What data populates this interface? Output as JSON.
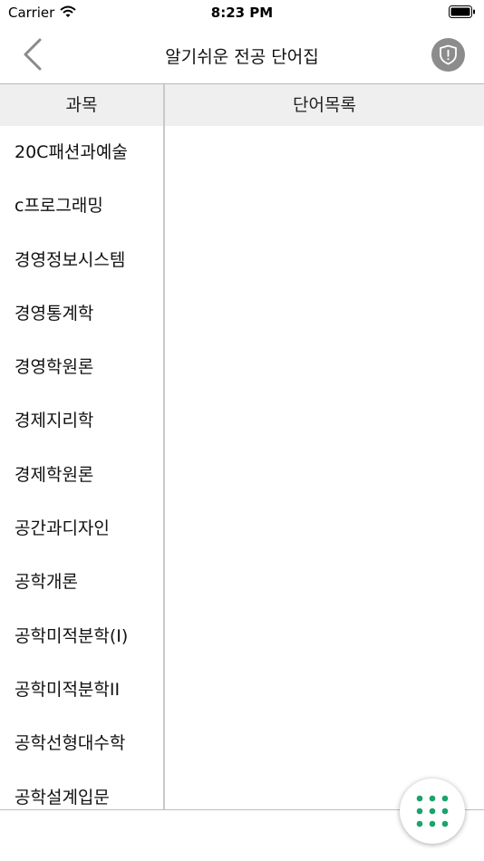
{
  "status_bar": {
    "carrier": "Carrier",
    "time": "8:23 PM"
  },
  "nav": {
    "title": "알기쉬운 전공 단어집",
    "back_icon": "chevron-left-icon",
    "report_icon": "shield-alert-icon"
  },
  "table": {
    "headers": {
      "subject": "과목",
      "words": "단어목록"
    },
    "subjects": [
      "20C패션과예술",
      "c프로그래밍",
      "경영정보시스템",
      "경영통계학",
      "경영학원론",
      "경제지리학",
      "경제학원론",
      "공간과디자인",
      "공학개론",
      "공학미적분학(I)",
      "공학미적분학II",
      "공학선형대수학",
      "공학설계입문"
    ]
  },
  "fab": {
    "icon": "grid-menu-icon",
    "color": "#1aa36a"
  },
  "colors": {
    "header_bg": "#efefef",
    "report_button": "#8c8c8c"
  }
}
